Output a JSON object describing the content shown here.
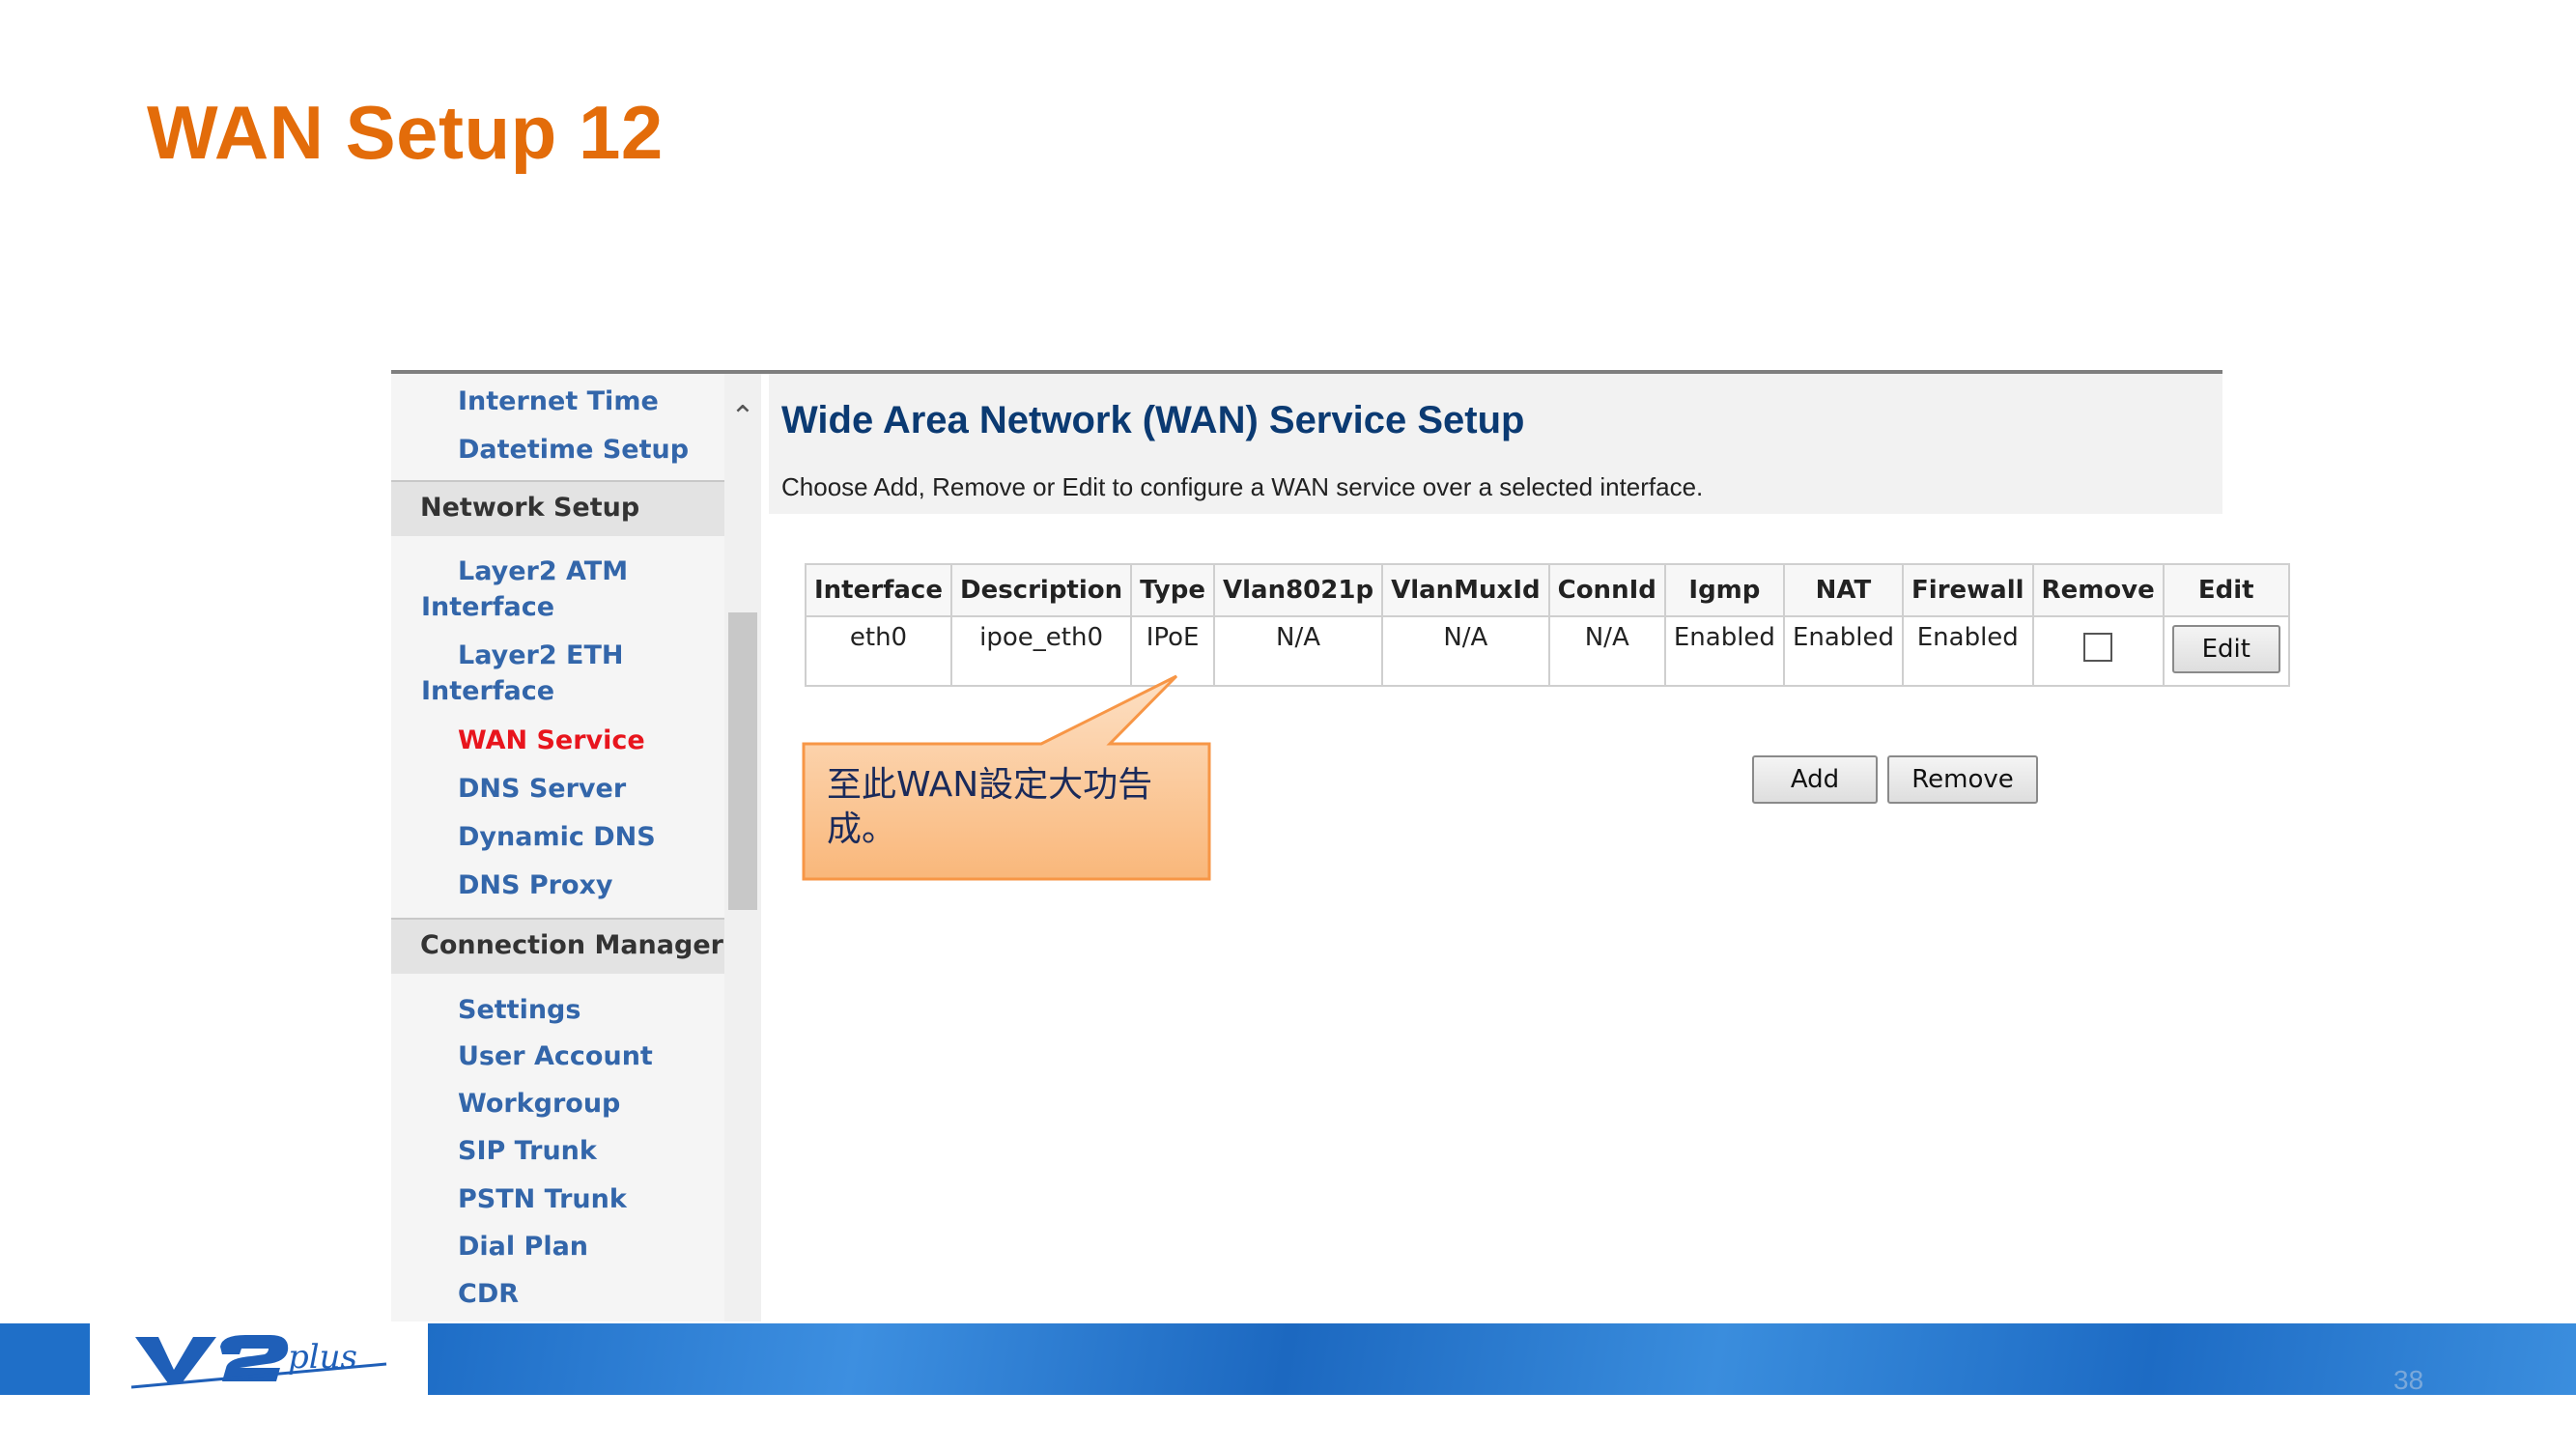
{
  "slide": {
    "title": "WAN Setup 12",
    "page_number": "38"
  },
  "sidebar": {
    "items_top": [
      {
        "label": "Internet Time"
      },
      {
        "label": "Datetime Setup"
      }
    ],
    "network_setup": "Network Setup",
    "network_items": [
      {
        "label": "Layer2 ATM Interface"
      },
      {
        "label": "Layer2 ETH Interface"
      },
      {
        "label": "WAN Service"
      },
      {
        "label": "DNS Server"
      },
      {
        "label": "Dynamic DNS"
      },
      {
        "label": "DNS Proxy"
      }
    ],
    "connection_manager": "Connection Manager",
    "connection_items": [
      {
        "label": "Settings"
      },
      {
        "label": "User Account"
      },
      {
        "label": "Workgroup"
      },
      {
        "label": "SIP Trunk"
      },
      {
        "label": "PSTN Trunk"
      },
      {
        "label": "Dial Plan"
      },
      {
        "label": "CDR"
      }
    ]
  },
  "main": {
    "title": "Wide Area Network (WAN) Service Setup",
    "description": "Choose Add, Remove or Edit to configure a WAN service over a selected interface.",
    "table": {
      "headers": [
        "Interface",
        "Description",
        "Type",
        "Vlan8021p",
        "VlanMuxId",
        "ConnId",
        "Igmp",
        "NAT",
        "Firewall",
        "Remove",
        "Edit"
      ],
      "rows": [
        {
          "interface": "eth0",
          "description": "ipoe_eth0",
          "type": "IPoE",
          "vlan8021p": "N/A",
          "vlanmuxid": "N/A",
          "connid": "N/A",
          "igmp": "Enabled",
          "nat": "Enabled",
          "firewall": "Enabled",
          "edit_label": "Edit"
        }
      ]
    },
    "add_label": "Add",
    "remove_label": "Remove"
  },
  "callout": {
    "text": "至此WAN設定大功告成。"
  },
  "colors": {
    "title": "#e36c0a",
    "link": "#3366aa",
    "active_link": "#e8151d",
    "heading": "#0b3a72",
    "footer_blue": "#1f6fc8",
    "callout_fill": "#fbc08a"
  },
  "icons": {
    "scroll_up": "chevron-up-icon",
    "logo": "v2plus-logo"
  }
}
